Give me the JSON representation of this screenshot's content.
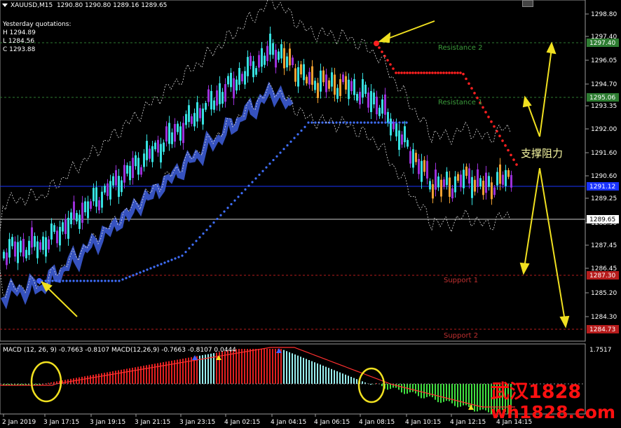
{
  "header": {
    "symbol_text": "XAUUSD,M15",
    "ohlc_text": "1290.80 1290.80 1289.16 1289.65",
    "yesterday_title": "Yesterday quotations:",
    "high": "H 1294.89",
    "low": "L 1284.56",
    "close": "C 1293.88"
  },
  "levels": {
    "resistance2": "Resistance 2",
    "resistance1": "Resistance 1",
    "support1": "Support 1",
    "support2": "Support 2"
  },
  "annotation_text": "支撑阻力",
  "watermark": {
    "line1": "武汉1828",
    "line2": "wh1828.com"
  },
  "macd": {
    "label": "MACD (12, 26, 9)  -0.7663 -0.8107  MACD(12,26,9) -0.7663 -0.8107 0.0444",
    "top_value": "1.7517"
  },
  "price_axis": {
    "ticks": [
      "1298.80",
      "1297.40",
      "1296.05",
      "1294.70",
      "1293.35",
      "1292.00",
      "1291.60",
      "1290.60",
      "1289.25",
      "1288.50",
      "1287.45",
      "1286.45",
      "1285.20",
      "1284.30"
    ],
    "tags": [
      {
        "text": "1297.40",
        "color": "#2e7d32",
        "level": "resistance2"
      },
      {
        "text": "1295.06",
        "color": "#2e7d32",
        "level": "resistance1"
      },
      {
        "text": "1291.12",
        "color": "#1a33ff",
        "level": "blue"
      },
      {
        "text": "1289.65",
        "color": "#000000",
        "level": "current"
      },
      {
        "text": "1287.30",
        "color": "#b71c1c",
        "level": "support1"
      },
      {
        "text": "1284.73",
        "color": "#b71c1c",
        "level": "support2"
      }
    ]
  },
  "time_axis": {
    "labels": [
      "2 Jan 2019",
      "3 Jan 17:15",
      "3 Jan 19:15",
      "3 Jan 21:15",
      "3 Jan 23:15",
      "4 Jan 02:15",
      "4 Jan 04:15",
      "4 Jan 06:15",
      "4 Jan 08:15",
      "4 Jan 10:15",
      "4 Jan 12:15",
      "4 Jan 14:15"
    ]
  },
  "colors": {
    "background": "#000000",
    "bull_candle": "#36e0e0",
    "bear_candle": "#9b30d9",
    "orange_candle": "#f0a030",
    "blue_band": "#4060e0",
    "red_line": "#ff2020",
    "macd_red": "#e02020",
    "macd_green": "#40e040",
    "macd_cyan": "#9ee",
    "annotation_yellow": "#f0e020",
    "watermark_red": "#ff1010",
    "resistance_green": "#3a9a3a",
    "support_red": "#c03030"
  },
  "icons": {
    "menu": "triangle-down-icon",
    "window_button": "window-button-icon"
  }
}
